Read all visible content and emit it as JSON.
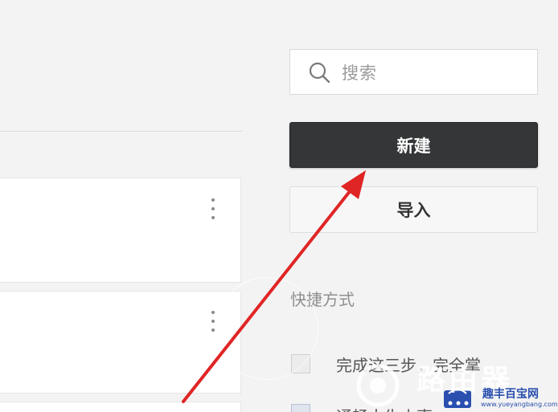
{
  "search": {
    "placeholder": "搜索"
  },
  "buttons": {
    "new_label": "新建",
    "import_label": "导入"
  },
  "shortcuts": {
    "title": "快捷方式",
    "items": [
      {
        "label": "完成这三步，完全掌"
      },
      {
        "label": "通畅人生小事"
      }
    ]
  },
  "watermark": {
    "big_text": "路由器",
    "name": "趣丰百宝网",
    "url": "www.yueyangbang.com"
  },
  "annotation": {
    "arrow_color": "#e02525"
  },
  "colors": {
    "primary_button": "#343638",
    "background": "#f3f3f3"
  }
}
